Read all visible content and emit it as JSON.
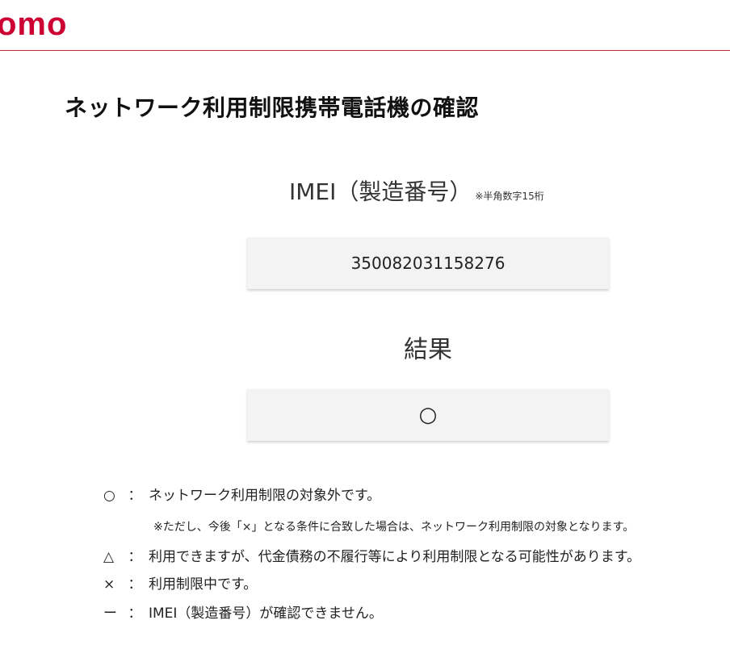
{
  "header": {
    "logo_text": "omo",
    "brand_color": "#cc0033"
  },
  "page": {
    "title": "ネットワーク利用制限携帯電話機の確認"
  },
  "imei": {
    "label": "IMEI（製造番号）",
    "note": "※半角数字15桁",
    "value": "350082031158276"
  },
  "result": {
    "label": "結果",
    "value": "○"
  },
  "legend": {
    "separator": "：",
    "items": [
      {
        "symbol": "○",
        "text": "ネットワーク利用制限の対象外です。"
      },
      {
        "symbol": "△",
        "text": "利用できますが、代金債務の不履行等により利用制限となる可能性があります。"
      },
      {
        "symbol": "×",
        "text": "利用制限中です。"
      },
      {
        "symbol": "ー",
        "text": "IMEI（製造番号）が確認できません。"
      }
    ],
    "note": "※ただし、今後「×」となる条件に合致した場合は、ネットワーク利用制限の対象となります。"
  }
}
